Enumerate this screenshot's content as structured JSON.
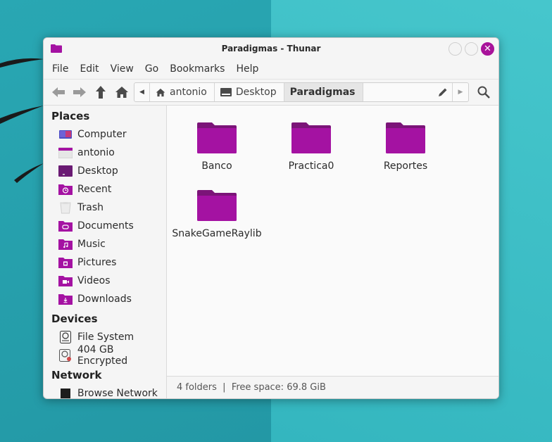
{
  "window": {
    "title": "Paradigmas - Thunar"
  },
  "menu": [
    "File",
    "Edit",
    "View",
    "Go",
    "Bookmarks",
    "Help"
  ],
  "pathbar": {
    "crumbs": [
      "antonio",
      "Desktop",
      "Paradigmas"
    ]
  },
  "sidebar": {
    "sections": [
      {
        "title": "Places",
        "items": [
          "Computer",
          "antonio",
          "Desktop",
          "Recent",
          "Trash",
          "Documents",
          "Music",
          "Pictures",
          "Videos",
          "Downloads"
        ]
      },
      {
        "title": "Devices",
        "items": [
          "File System",
          "404 GB Encrypted"
        ]
      },
      {
        "title": "Network",
        "items": [
          "Browse Network"
        ]
      }
    ]
  },
  "files": [
    "Banco",
    "Practica0",
    "Reportes",
    "SnakeGameRaylib"
  ],
  "status": "4 folders  |  Free space: 69.8 GiB",
  "colors": {
    "accent": "#a8139a",
    "folder": "#a412a2"
  }
}
